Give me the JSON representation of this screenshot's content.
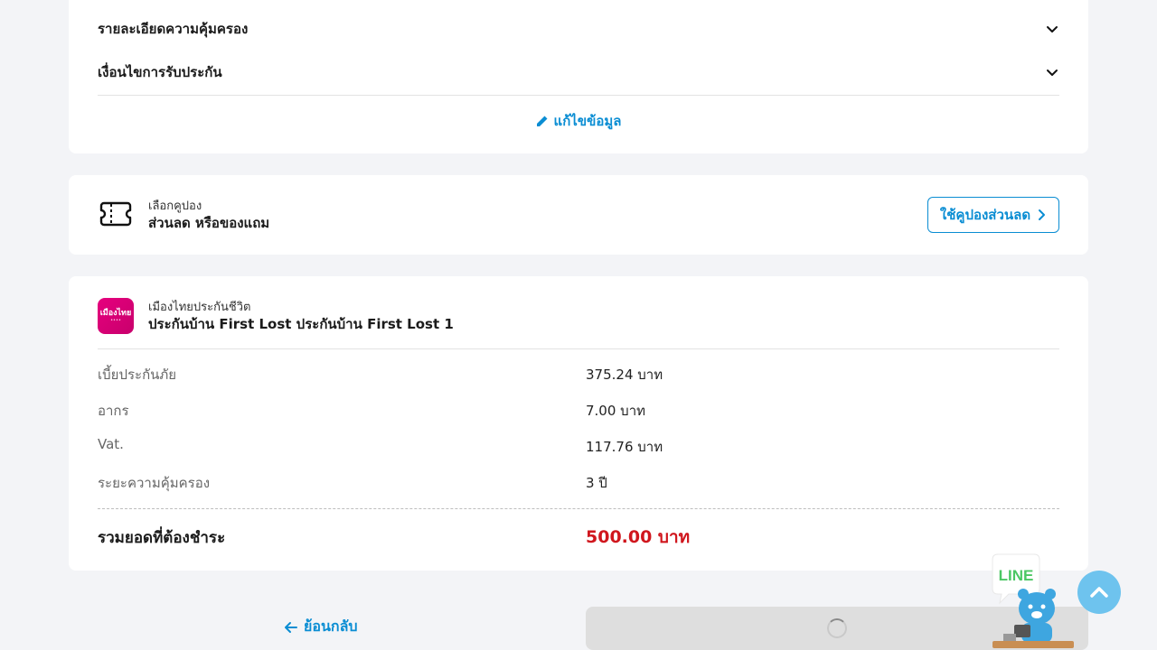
{
  "coverage": {
    "details_label": "รายละเอียดความคุ้มครอง",
    "conditions_label": "เงื่อนไขการรับประกัน",
    "edit_label": "แก้ไขข้อมูล"
  },
  "coupon": {
    "small_label": "เลือกคูปอง",
    "big_label": "ส่วนลด หรือของแถม",
    "button_label": "ใช้คูปองส่วนลด"
  },
  "summary": {
    "logo_text": "เมืองไทย",
    "insurer": "เมืองไทยประกันชีวิต",
    "product": "ประกันบ้าน First Lost ประกันบ้าน First Lost 1",
    "rows": [
      {
        "label": "เบี้ยประกันภัย",
        "value": "375.24 บาท"
      },
      {
        "label": "อากร",
        "value": "7.00 บาท"
      },
      {
        "label": "Vat.",
        "value": "117.76 บาท"
      },
      {
        "label": "ระยะความคุ้มครอง",
        "value": "3 ปี"
      }
    ],
    "total_label": "รวมยอดที่ต้องชำระ",
    "total_value": "500.00 บาท"
  },
  "footer": {
    "back_label": "ย้อนกลับ"
  },
  "line_widget": {
    "label": "LINE"
  },
  "colors": {
    "accent": "#0a8dd3",
    "total": "#d0161d",
    "brand_pink": "#e6007e",
    "line_green": "#4cc764"
  }
}
